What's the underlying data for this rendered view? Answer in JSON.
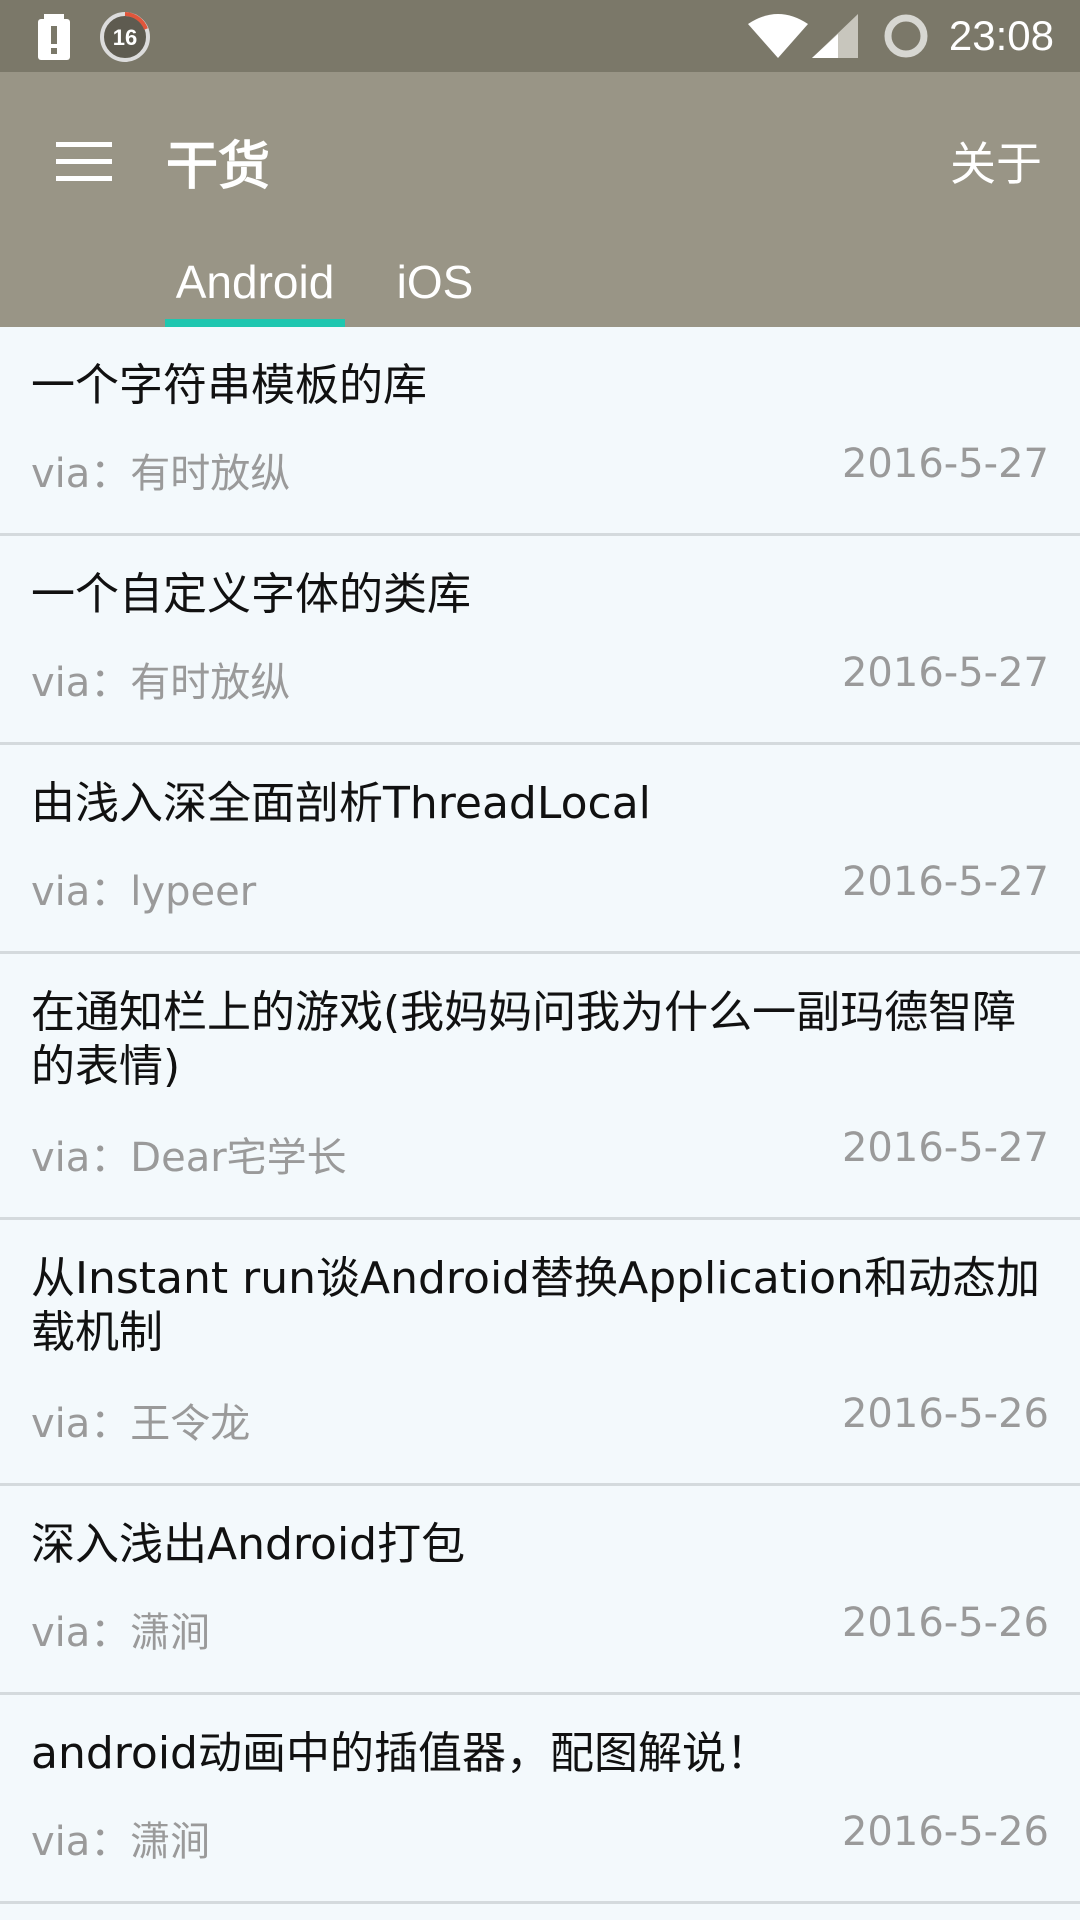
{
  "status_bar": {
    "time": "23:08",
    "notification_badge": "16",
    "icons": [
      "alert-icon",
      "download-progress-icon",
      "wifi-icon",
      "signal-icon",
      "sync-icon"
    ]
  },
  "app_bar": {
    "title": "干货",
    "about_label": "关于",
    "menu_icon": "hamburger-menu-icon"
  },
  "tabs": [
    {
      "label": "Android",
      "selected": true
    },
    {
      "label": "iOS",
      "selected": false
    }
  ],
  "colors": {
    "status_bar": "#7b7869",
    "app_bar": "#999586",
    "tab_indicator": "#1ec7b0",
    "list_background": "#f3f9fc"
  },
  "articles": [
    {
      "title": "一个字符串模板的库",
      "via": "via：有时放纵",
      "date": "2016-5-27"
    },
    {
      "title": "一个自定义字体的类库",
      "via": "via：有时放纵",
      "date": "2016-5-27"
    },
    {
      "title": "由浅入深全面剖析ThreadLocal",
      "via": "via：lypeer",
      "date": "2016-5-27"
    },
    {
      "title": "在通知栏上的游戏(我妈妈问我为什么一副玛德智障的表情)",
      "via": "via：Dear宅学长",
      "date": "2016-5-27"
    },
    {
      "title": "从Instant run谈Android替换Application和动态加载机制",
      "via": "via：王令龙",
      "date": "2016-5-26"
    },
    {
      "title": "深入浅出Android打包",
      "via": "via：潇涧",
      "date": "2016-5-26"
    },
    {
      "title": "android动画中的插值器，配图解说！",
      "via": "via：潇涧",
      "date": "2016-5-26"
    }
  ]
}
